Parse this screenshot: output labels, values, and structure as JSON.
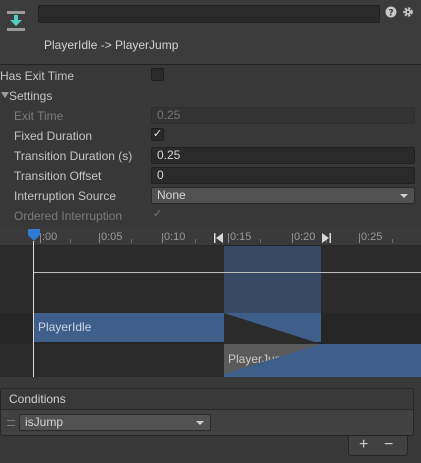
{
  "header": {
    "transition_title": "PlayerIdle -> PlayerJump",
    "name_value": ""
  },
  "settings": {
    "has_exit_time_label": "Has Exit Time",
    "has_exit_time_checked": false,
    "settings_label": "Settings",
    "exit_time_label": "Exit Time",
    "exit_time_value": "0.25",
    "fixed_duration_label": "Fixed Duration",
    "fixed_duration_checked": true,
    "transition_duration_label": "Transition Duration (s)",
    "transition_duration_value": "0.25",
    "transition_offset_label": "Transition Offset",
    "transition_offset_value": "0",
    "interruption_source_label": "Interruption Source",
    "interruption_source_value": "None",
    "ordered_interruption_label": "Ordered Interruption",
    "ordered_interruption_checked": true
  },
  "timeline": {
    "ticks": [
      ":00",
      "0:05",
      "0:10",
      "0:15",
      "0:20",
      "0:25"
    ],
    "clip_from": "PlayerIdle",
    "clip_to": "PlayerJump"
  },
  "conditions": {
    "title": "Conditions",
    "items": [
      {
        "parameter": "isJump"
      }
    ],
    "add_label": "+",
    "remove_label": "−"
  },
  "colors": {
    "accent": "#3e5f8a",
    "highlight": "#466eaa",
    "playhead": "#2e7cd6"
  }
}
